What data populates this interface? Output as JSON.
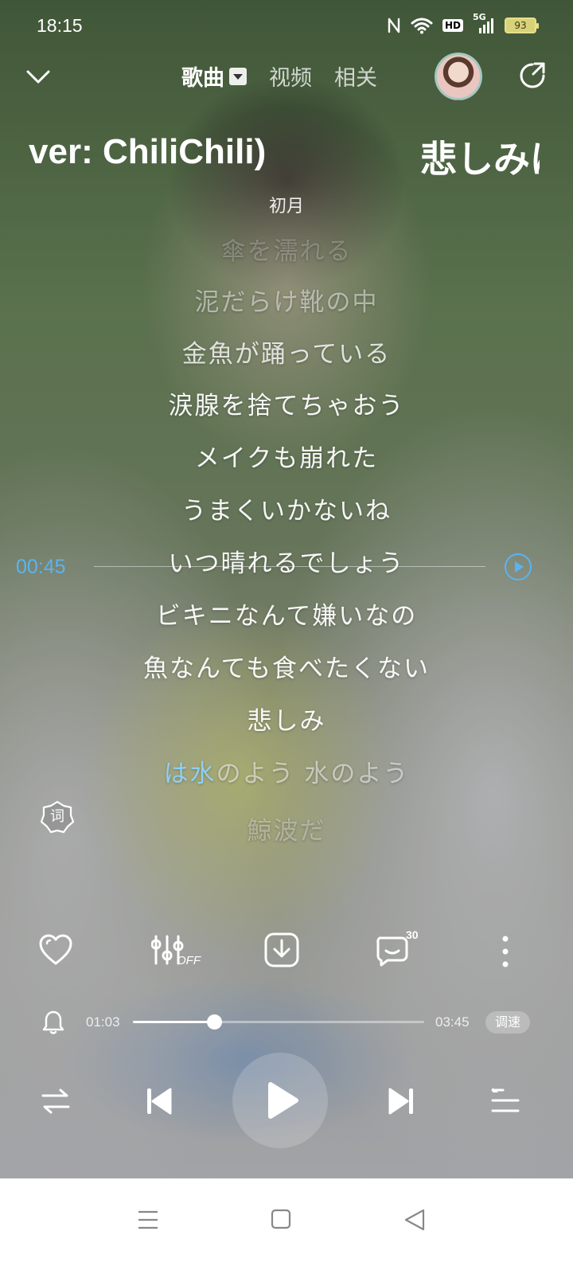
{
  "status_bar": {
    "time": "18:15",
    "hd_label": "HD",
    "network_label": "5G",
    "battery": "93"
  },
  "top_nav": {
    "tabs": [
      {
        "label": "歌曲",
        "active": true
      },
      {
        "label": "视频",
        "active": false
      },
      {
        "label": "相关",
        "active": false
      }
    ]
  },
  "song": {
    "title_left": "ver: ChiliChili)",
    "title_right": "悲しみは",
    "artist": "初月"
  },
  "lyrics": {
    "lines": [
      "傘を濡れる",
      "泥だらけ靴の中",
      "金魚が踊っている",
      "涙腺を捨てちゃおう",
      "メイクも崩れた",
      "うまくいかないね",
      "いつ晴れるでしょう",
      "ビキニなんて嫌いなの",
      "魚なんても食べたくない",
      "悲しみ"
    ],
    "current_line": {
      "highlighted": "は水",
      "rest": "のよう 水のよう"
    },
    "next_line": "鯨波だ",
    "seek_time": "00:45"
  },
  "lyric_toggle_label": "词",
  "actions": {
    "comment_count": "30",
    "effect_label": "OFF"
  },
  "progress": {
    "elapsed": "01:03",
    "total": "03:45",
    "fraction": 0.28,
    "speed_label": "调速"
  },
  "icons": [
    "chevron-down-icon",
    "share-icon",
    "heart-icon",
    "equalizer-icon",
    "download-icon",
    "comment-icon",
    "more-icon",
    "alarm-icon",
    "repeat-icon",
    "previous-icon",
    "play-icon",
    "next-icon",
    "playlist-icon"
  ],
  "colors": {
    "accent": "#5ab4f0",
    "lyric_highlight": "#8fd0f0"
  }
}
